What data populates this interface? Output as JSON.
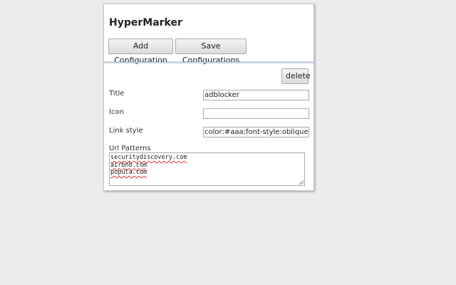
{
  "app": {
    "title": "HyperMarker"
  },
  "toolbar": {
    "add_label": "Add Configuration",
    "save_label": "Save Configurations"
  },
  "config": {
    "delete_label": "delete",
    "title_label": "Title",
    "title_value": "adblocker",
    "icon_label": "Icon",
    "icon_value": "",
    "link_style_label": "Link style",
    "link_style_value": "color:#aaa;font-style:oblique",
    "url_patterns_label": "Url Patterns",
    "url_patterns": [
      "securitydiscovery.com",
      "airbnb.com",
      "popula.com"
    ]
  }
}
